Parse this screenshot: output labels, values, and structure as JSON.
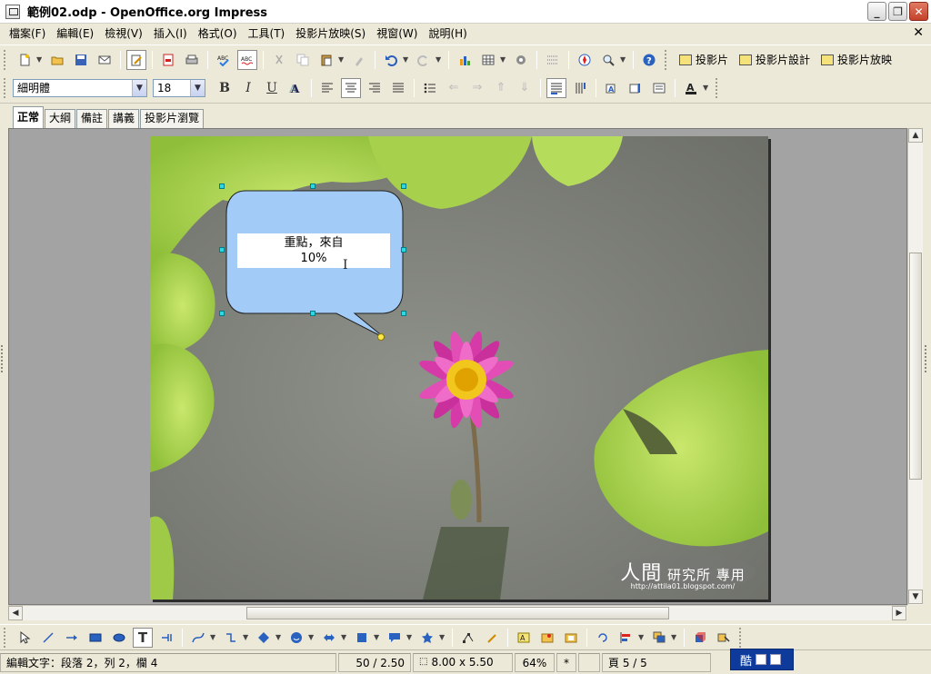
{
  "window": {
    "title": "範例02.odp - OpenOffice.org Impress"
  },
  "menu": [
    "檔案(F)",
    "編輯(E)",
    "檢視(V)",
    "插入(I)",
    "格式(O)",
    "工具(T)",
    "投影片放映(S)",
    "視窗(W)",
    "說明(H)"
  ],
  "toolbar": {
    "slide_label": "投影片",
    "slide_design_label": "投影片設計",
    "slideshow_label": "投影片放映"
  },
  "format": {
    "font_name": "細明體",
    "font_size": "18"
  },
  "tabs": [
    "正常",
    "大綱",
    "備註",
    "講義",
    "投影片瀏覽"
  ],
  "slide": {
    "callout_line1": "重點，來自",
    "callout_line2": "10%",
    "watermark_main": "人間",
    "watermark_sub": "研究所 專用",
    "watermark_url": "http://attila01.blogspot.com/"
  },
  "status": {
    "edit_info": "編輯文字：段落 2，列 2，欄 4",
    "position": "50 / 2.50",
    "size": "8.00 x 5.50",
    "zoom": "64%",
    "modified": "*",
    "page": "頁 5 / 5",
    "ime": "酷"
  },
  "colors": {
    "callout_fill": "#a3cbf7",
    "handle": "#2ed8e0",
    "lotus": "#d63aa8"
  }
}
